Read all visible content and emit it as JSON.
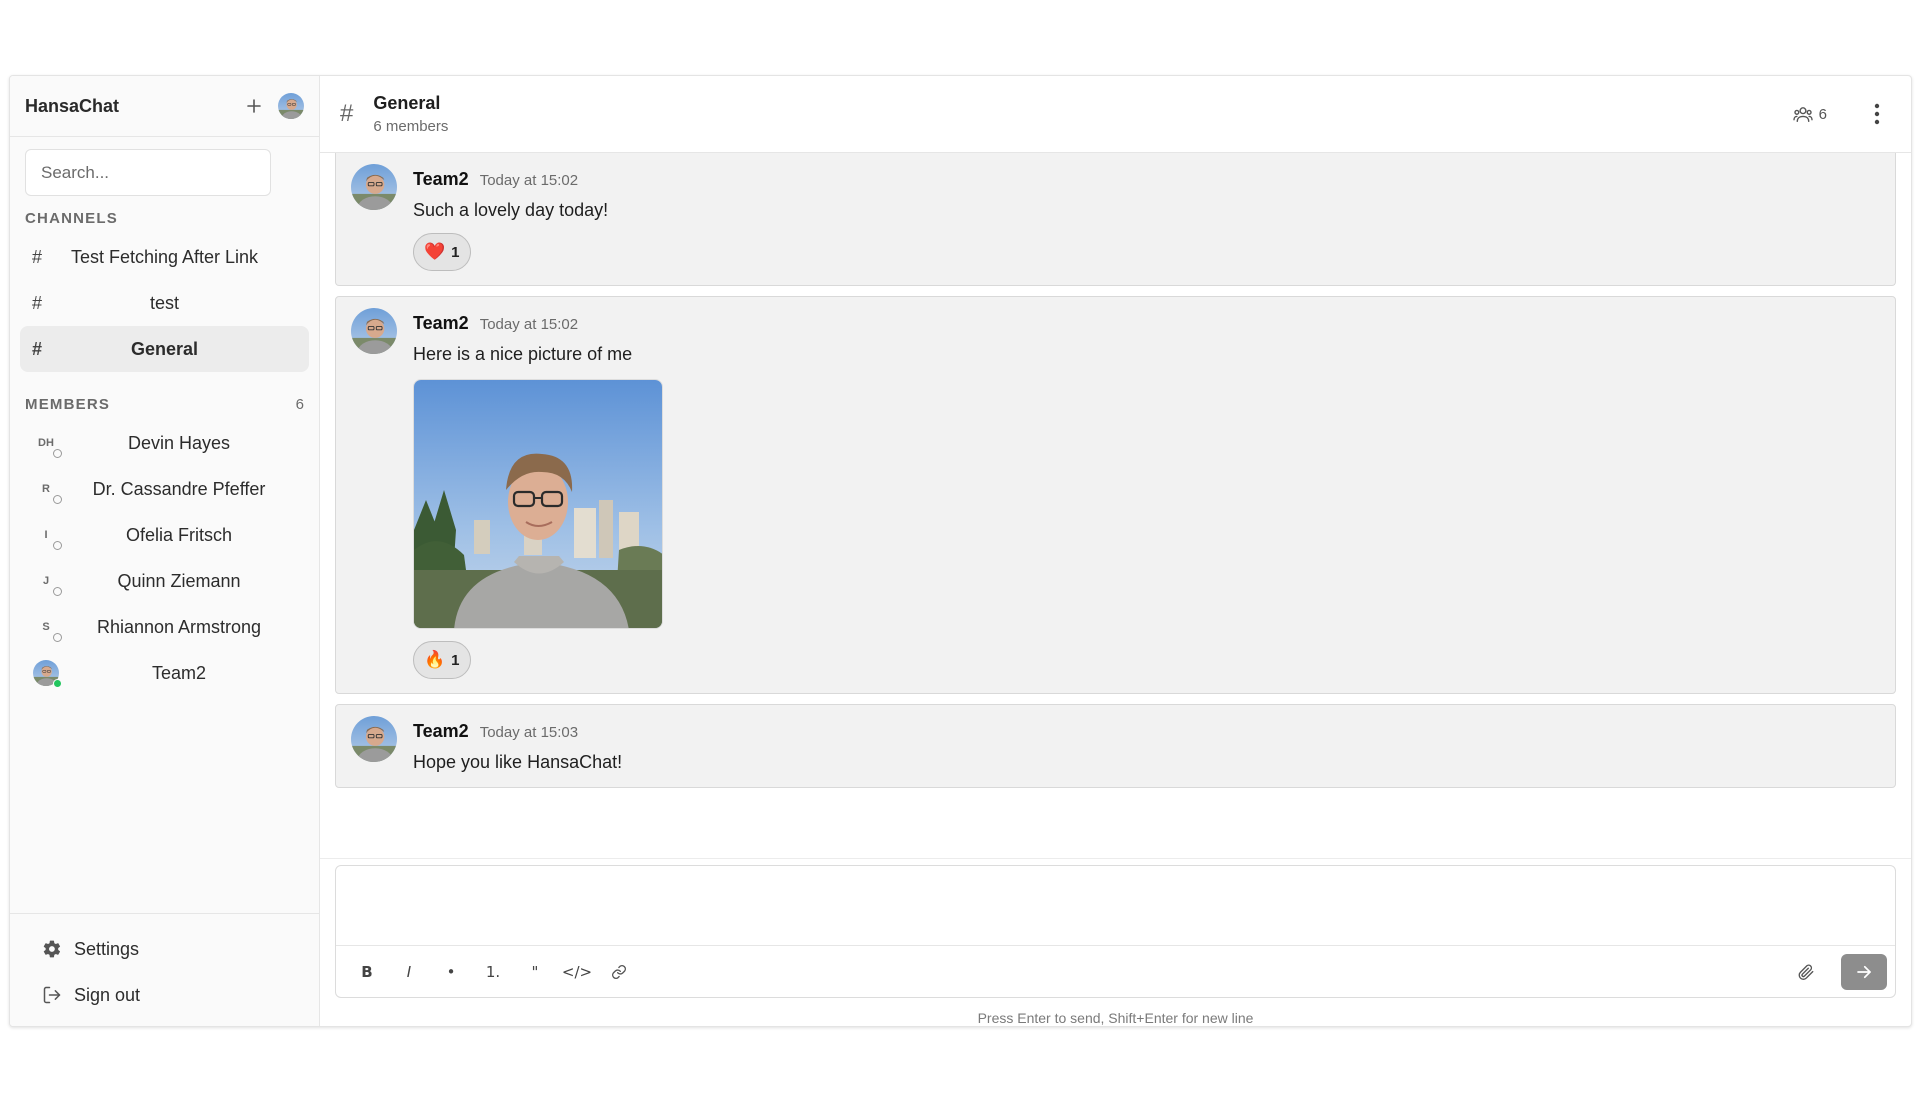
{
  "app": {
    "name": "HansaChat"
  },
  "search": {
    "placeholder": "Search..."
  },
  "channels": {
    "title": "CHANNELS",
    "items": [
      {
        "label": "Test Fetching After Link",
        "active": false
      },
      {
        "label": "test",
        "active": false
      },
      {
        "label": "General",
        "active": true
      }
    ]
  },
  "members": {
    "title": "MEMBERS",
    "count": "6",
    "items": [
      {
        "initials": "DH",
        "name": "Devin Hayes",
        "status": "offline"
      },
      {
        "initials": "R",
        "name": "Dr. Cassandre Pfeffer",
        "status": "offline"
      },
      {
        "initials": "I",
        "name": "Ofelia Fritsch",
        "status": "offline"
      },
      {
        "initials": "J",
        "name": "Quinn Ziemann",
        "status": "offline"
      },
      {
        "initials": "S",
        "name": "Rhiannon Armstrong",
        "status": "offline"
      },
      {
        "initials": "",
        "name": "Team2",
        "status": "online"
      }
    ]
  },
  "footer": {
    "settings_label": "Settings",
    "signout_label": "Sign out"
  },
  "header": {
    "channel_name": "General",
    "subtitle": "6 members",
    "member_count": "6"
  },
  "messages": [
    {
      "author": "Team2",
      "time": "Today at 15:02",
      "text": "Such a lovely day today!",
      "reaction": {
        "emoji": "❤️",
        "count": "1"
      }
    },
    {
      "author": "Team2",
      "time": "Today at 15:02",
      "text": "Here is a nice picture of me",
      "has_image": true,
      "reaction": {
        "emoji": "🔥",
        "count": "1"
      }
    },
    {
      "author": "Team2",
      "time": "Today at 15:03",
      "text": "Hope you like HansaChat!"
    }
  ],
  "composer": {
    "toolbar": {
      "bold": "B",
      "italic": "I",
      "bullet": "•",
      "ordered": "1.",
      "quote": "\"",
      "code": "</>"
    },
    "hint": "Press Enter to send, Shift+Enter for new line"
  },
  "colors": {
    "accent": "#22c55e",
    "send_button": "#8d8d8d",
    "message_bg": "#f2f2f2"
  },
  "icons": [
    "plus-icon",
    "hash-icon",
    "gear-icon",
    "sign-out-icon",
    "users-icon",
    "kebab-icon",
    "paperclip-icon",
    "arrow-right-icon",
    "link-icon"
  ]
}
